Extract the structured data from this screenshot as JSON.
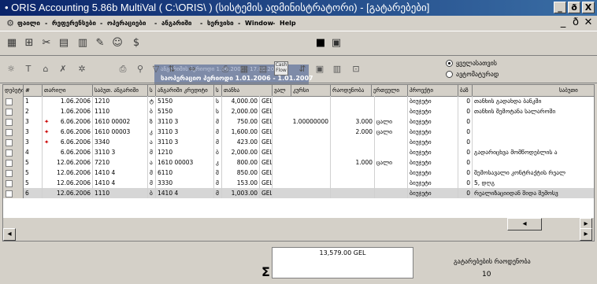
{
  "window": {
    "title": "• ORIS Accounting 5.86b MultiVal   ( C:\\ORIS\\ ) (სისტემის ადმინისტრატორი) - [გატარებები]",
    "minimize": "_",
    "maximize": "ð",
    "close": "X"
  },
  "menu": {
    "items": [
      "ფაილი",
      "რეფერენსები",
      "ოპერაციები",
      "ანგარიში",
      "სერვისი",
      "Window",
      "Help"
    ],
    "separators": [
      "-",
      "-",
      "-",
      "-",
      "-",
      "-"
    ]
  },
  "period": {
    "line1": "ანგარიშის პერიოდი  1.06.2006 - 17.06.2006",
    "line2": "საოპერაციო პერიოდი  1.01.2006 -  1.01.2007"
  },
  "filter": {
    "option1": "ყველასათვის",
    "option2": "ავტომატურად",
    "selected": "option1"
  },
  "columns": [
    "დებეტი",
    "#",
    "თარიღი",
    "საბუთ. ანგარიში",
    "ს",
    "ანგარიში კრედიტი",
    "ს",
    "თანხა",
    "ვალ",
    "კურსი",
    "რაოდენობა",
    "ერთეული",
    "პროექტი",
    "ბაზ",
    "საბუთი"
  ],
  "rows": [
    {
      "n": "1",
      "icon": false,
      "date": "1.06.2006",
      "debit": "1210",
      "s1": "ტ",
      "credit": "5150",
      "s2": "ს",
      "amount": "4,000.00",
      "cur": "GEL",
      "rate": "",
      "qty": "",
      "unit": "",
      "proj": "ბიუჯეტი",
      "base": "0",
      "doc": "თანხის გადახდა ბანკში",
      "sel": false
    },
    {
      "n": "2",
      "icon": false,
      "date": "1.06.2006",
      "debit": "1110",
      "s1": "ბ",
      "credit": "5150",
      "s2": "ს",
      "amount": "2,000.00",
      "cur": "GEL",
      "rate": "",
      "qty": "",
      "unit": "",
      "proj": "ბიუჯეტი",
      "base": "0",
      "doc": "თანხის შემოტანა სალაროში",
      "sel": false
    },
    {
      "n": "3",
      "icon": true,
      "date": "6.06.2006",
      "debit": "1610 00002",
      "s1": "ზ",
      "credit": "3110 3",
      "s2": "მ",
      "amount": "750.00",
      "cur": "GEL",
      "rate": "1.00000000",
      "qty": "3.000",
      "unit": "ცალი",
      "proj": "ბიუჯეტი",
      "base": "0",
      "doc": "",
      "sel": false
    },
    {
      "n": "3",
      "icon": true,
      "date": "6.06.2006",
      "debit": "1610 00003",
      "s1": "კ",
      "credit": "3110 3",
      "s2": "მ",
      "amount": "1,600.00",
      "cur": "GEL",
      "rate": "",
      "qty": "2.000",
      "unit": "ცალი",
      "proj": "ბიუჯეტი",
      "base": "0",
      "doc": "",
      "sel": false
    },
    {
      "n": "3",
      "icon": true,
      "date": "6.06.2006",
      "debit": "3340",
      "s1": "ა",
      "credit": "3110 3",
      "s2": "მ",
      "amount": "423.00",
      "cur": "GEL",
      "rate": "",
      "qty": "",
      "unit": "",
      "proj": "ბიუჯეტი",
      "base": "0",
      "doc": "",
      "sel": false
    },
    {
      "n": "4",
      "icon": false,
      "date": "6.06.2006",
      "debit": "3110 3",
      "s1": "მ",
      "credit": "1210",
      "s2": "ბ",
      "amount": "2,000.00",
      "cur": "GEL",
      "rate": "",
      "qty": "",
      "unit": "",
      "proj": "ბიუჯეტი",
      "base": "0",
      "doc": "გადარიცხვა მომწოდებლის ა",
      "sel": false
    },
    {
      "n": "5",
      "icon": false,
      "date": "12.06.2006",
      "debit": "7210",
      "s1": "ა",
      "credit": "1610 00003",
      "s2": "კ",
      "amount": "800.00",
      "cur": "GEL",
      "rate": "",
      "qty": "1.000",
      "unit": "ცალი",
      "proj": "ბიუჯეტი",
      "base": "0",
      "doc": "",
      "sel": false
    },
    {
      "n": "5",
      "icon": false,
      "date": "12.06.2006",
      "debit": "1410 4",
      "s1": "მ",
      "credit": "6110",
      "s2": "შ",
      "amount": "850.00",
      "cur": "GEL",
      "rate": "",
      "qty": "",
      "unit": "",
      "proj": "ბიუჯეტი",
      "base": "0",
      "doc": "შემოსავალი კონტრაქტის რეალ",
      "sel": false
    },
    {
      "n": "5",
      "icon": false,
      "date": "12.06.2006",
      "debit": "1410 4",
      "s1": "მ",
      "credit": "3330",
      "s2": "მ",
      "amount": "153.00",
      "cur": "GEL",
      "rate": "",
      "qty": "",
      "unit": "",
      "proj": "ბიუჯეტი",
      "base": "0",
      "doc": "5, დღგ",
      "sel": false
    },
    {
      "n": "6",
      "icon": false,
      "date": "12.06.2006",
      "debit": "1110",
      "s1": "ბ",
      "credit": "1410 4",
      "s2": "მ",
      "amount": "1,003.00",
      "cur": "GEL",
      "rate": "",
      "qty": "",
      "unit": "",
      "proj": "ბიუჯეტი",
      "base": "0",
      "doc": "რეალიზაციიდან შიდა შემოსვ",
      "sel": true
    }
  ],
  "footer": {
    "sigma": "Σ",
    "total": "13,579.00 GEL",
    "count_label": "გატარებების რაოდენობა",
    "count_value": "10"
  },
  "colors": {
    "title_start": "#0a246a",
    "title_end": "#3a6ea5",
    "period_bg": "#7e8ba8",
    "selected_row": "#d6d6d6"
  }
}
